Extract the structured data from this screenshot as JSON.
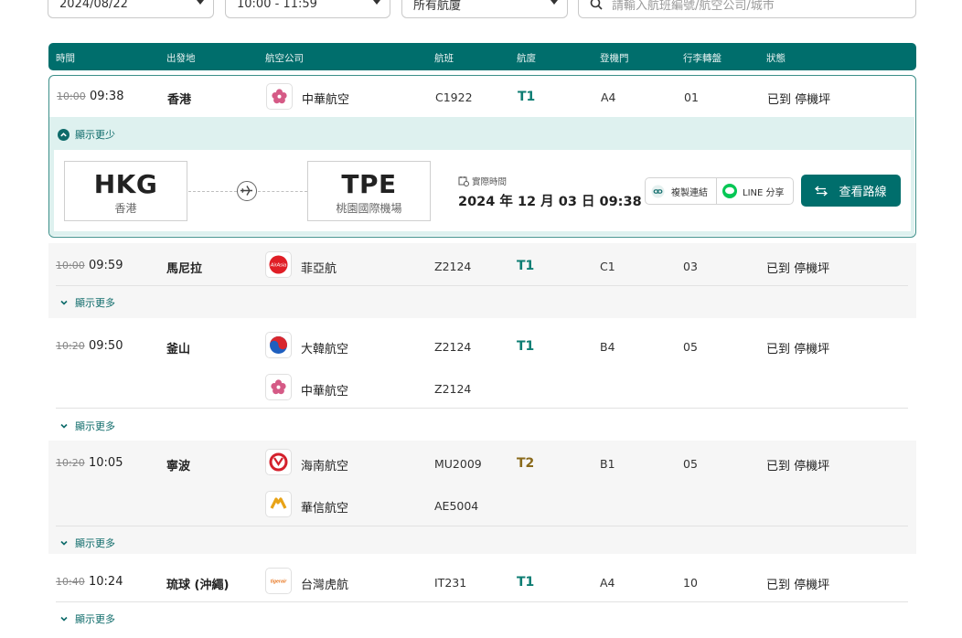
{
  "filters": {
    "date": "2024/08/22",
    "time_range": "10:00 - 11:59",
    "terminal": "所有航廈",
    "search_placeholder": "請輸入航班編號/航空公司/城市"
  },
  "columns": [
    "時間",
    "出發地",
    "航空公司",
    "航班",
    "航廈",
    "登機門",
    "行李轉盤",
    "狀態"
  ],
  "flights": [
    {
      "scheduled": "10:00",
      "actual": "09:38",
      "origin": "香港",
      "airlines": [
        {
          "name": "中華航空",
          "flight": "C1922",
          "logo": "china-airlines-plum-logo"
        }
      ],
      "terminal": "T1",
      "gate": "A4",
      "belt": "01",
      "status": "已到 停機坪"
    },
    {
      "scheduled": "10:00",
      "actual": "09:59",
      "origin": "馬尼拉",
      "airlines": [
        {
          "name": "菲亞航",
          "flight": "Z2124",
          "logo": "airasia-logo"
        }
      ],
      "terminal": "T1",
      "gate": "C1",
      "belt": "03",
      "status": "已到 停機坪"
    },
    {
      "scheduled": "10:20",
      "actual": "09:50",
      "origin": "釜山",
      "airlines": [
        {
          "name": "大韓航空",
          "flight": "Z2124",
          "logo": "korean-air-logo"
        },
        {
          "name": "中華航空",
          "flight": "Z2124",
          "logo": "china-airlines-plum-logo"
        }
      ],
      "terminal": "T1",
      "gate": "B4",
      "belt": "05",
      "status": "已到 停機坪"
    },
    {
      "scheduled": "10:20",
      "actual": "10:05",
      "origin": "寧波",
      "airlines": [
        {
          "name": "海南航空",
          "flight": "MU2009",
          "logo": "hainan-airlines-logo"
        },
        {
          "name": "華信航空",
          "flight": "AE5004",
          "logo": "mandarin-airlines-logo"
        }
      ],
      "terminal": "T2",
      "gate": "B1",
      "belt": "05",
      "status": "已到 停機坪"
    },
    {
      "scheduled": "10:40",
      "actual": "10:24",
      "origin": "琉球 (沖繩)",
      "airlines": [
        {
          "name": "台灣虎航",
          "flight": "IT231",
          "logo": "tigerair-logo"
        }
      ],
      "terminal": "T1",
      "gate": "A4",
      "belt": "10",
      "status": "已到 停機坪"
    }
  ],
  "expanded": {
    "toggle_label": "顯示更少",
    "origin_code": "HKG",
    "origin_city": "香港",
    "dest_code": "TPE",
    "dest_city": "桃園國際機場",
    "actual_label": "實際時間",
    "actual_datetime": "2024 年 12 月 03 日  09:38",
    "copy_label": "複製連結",
    "line_label": "LINE 分享",
    "route_label": "查看路線"
  },
  "show_more_label": "顯示更多",
  "tigerair_logo_text": "tigerair",
  "colors": {
    "primary": "#006e6c",
    "terminal_t1": "#0d7d73",
    "terminal_t2": "#8a6a1b",
    "expanded_bg": "#def1ef"
  }
}
